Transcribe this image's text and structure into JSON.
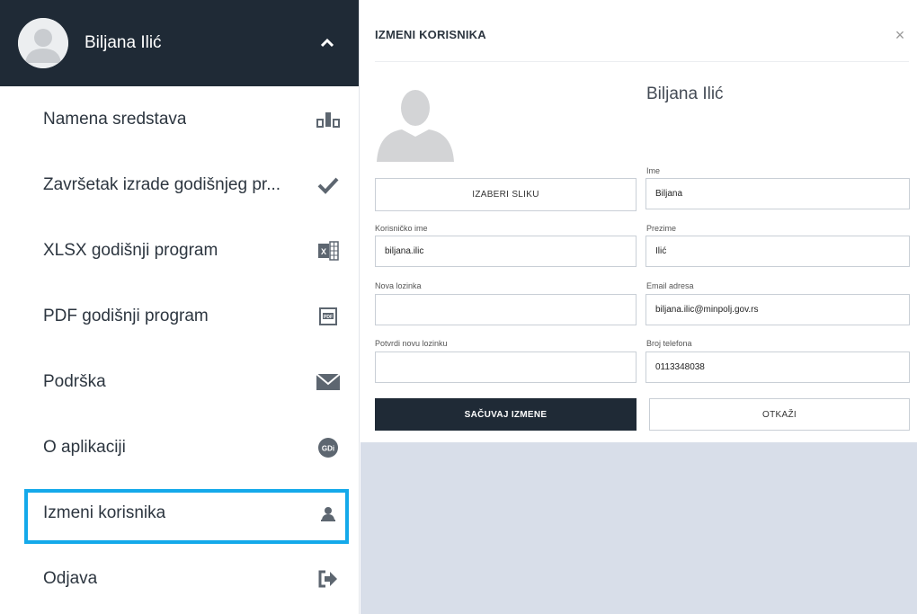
{
  "user": {
    "name": "Biljana Ilić"
  },
  "menu": [
    {
      "label": "Namena sredstava",
      "icon": "bar-chart-icon"
    },
    {
      "label": "Završetak izrade godišnjeg programa",
      "display": "Završetak izrade godišnjeg pr...",
      "icon": "check-icon"
    },
    {
      "label": "XLSX godišnji program",
      "icon": "excel-icon"
    },
    {
      "label": "PDF godišnji program",
      "icon": "pdf-icon"
    },
    {
      "label": "Podrška",
      "icon": "envelope-icon"
    },
    {
      "label": "O aplikaciji",
      "icon": "gdi-logo-icon"
    },
    {
      "label": "Izmeni korisnika",
      "icon": "user-icon"
    },
    {
      "label": "Odjava",
      "icon": "sign-out-icon"
    }
  ],
  "modal": {
    "title": "IZMENI KORISNIKA",
    "close": "×",
    "full_name": "Biljana Ilić",
    "choose_image": "IZABERI SLIKU",
    "fields": {
      "first_name": {
        "label": "Ime",
        "value": "Biljana"
      },
      "username": {
        "label": "Korisničko ime",
        "value": "biljana.ilic"
      },
      "last_name": {
        "label": "Prezime",
        "value": "Ilić"
      },
      "new_password": {
        "label": "Nova lozinka",
        "value": ""
      },
      "email": {
        "label": "Email adresa",
        "value": "biljana.ilic@minpolj.gov.rs"
      },
      "confirm_password": {
        "label": "Potvrdi novu lozinku",
        "value": ""
      },
      "phone": {
        "label": "Broj telefona",
        "value": "0113348038"
      }
    },
    "save": "SAČUVAJ IZMENE",
    "cancel": "OTKAŽI"
  },
  "colors": {
    "header_bg": "#1f2a36",
    "highlight": "#14a9ea",
    "backdrop": "#d8dee9"
  }
}
